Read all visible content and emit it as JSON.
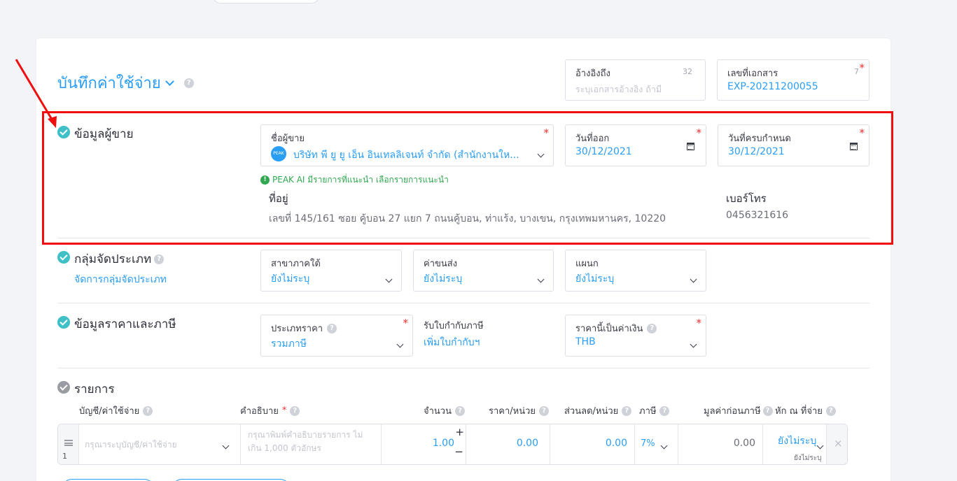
{
  "header": {
    "title": "บันทึกค่าใช้จ่าย"
  },
  "reference": {
    "label": "อ้างอิงถึง",
    "counter": "32",
    "placeholder": "ระบุเอกสารอ้างอิง ถ้ามี"
  },
  "document_no": {
    "label": "เลขที่เอกสาร",
    "counter": "7",
    "value": "EXP-20211200055"
  },
  "vendor_section": {
    "title": "ข้อมูลผู้ขาย",
    "vendor": {
      "label": "ชื่อผู้ขาย",
      "value": "บริษัท พี ยู ยู เอ็น อินเทลลิเจนท์ จำกัด (สำนักงานให...",
      "logo_text": "PEAK"
    },
    "issue_date": {
      "label": "วันที่ออก",
      "value": "30/12/2021"
    },
    "due_date": {
      "label": "วันที่ครบกำหนด",
      "value": "30/12/2021"
    },
    "ai_hint": "PEAK AI มีรายการที่แนะนำ เลือกรายการแนะนำ",
    "address_label": "ที่อยู่",
    "address": "เลขที่ 145/161 ซอย คู้บอน 27 แยก 7 ถนนคู้บอน, ท่าแร้ง, บางเขน, กรุงเทพมหานคร, 10220",
    "phone_label": "เบอร์โทร",
    "phone": "0456321616"
  },
  "group_section": {
    "title": "กลุ่มจัดประเภท",
    "manage_link": "จัดการกลุ่มจัดประเภท",
    "fields": [
      {
        "label": "สาขาภาคใต้",
        "value": "ยังไม่ระบุ"
      },
      {
        "label": "ค่าขนส่ง",
        "value": "ยังไม่ระบุ"
      },
      {
        "label": "แผนก",
        "value": "ยังไม่ระบุ"
      }
    ]
  },
  "price_section": {
    "title": "ข้อมูลราคาและภาษี",
    "price_type": {
      "label": "ประเภทราคา",
      "value": "รวมภาษี"
    },
    "tax_invoice": {
      "label": "รับใบกำกับภาษี",
      "link": "เพิ่มใบกำกับฯ"
    },
    "currency": {
      "label": "ราคานี้เป็นค่าเงิน",
      "value": "THB"
    }
  },
  "items_section": {
    "title": "รายการ",
    "columns": {
      "account": "บัญชี/ค่าใช้จ่าย",
      "description": "คำอธิบาย",
      "qty": "จำนวน",
      "unit_price": "ราคา/หน่วย",
      "discount": "ส่วนลด/หน่วย",
      "vat": "ภาษี",
      "pretax": "มูลค่าก่อนภาษี",
      "wht": "หัก ณ ที่จ่าย"
    },
    "row": {
      "index": "1",
      "account_placeholder": "กรุณาระบุบัญชี/ค่าใช้จ่าย",
      "description_placeholder": "กรุณาพิมพ์คำอธิบายรายการ ไม่เกิน 1,000 ตัวอักษร",
      "qty": "1.00",
      "unit_price": "0.00",
      "discount": "0.00",
      "vat": "7%",
      "pretax": "0.00",
      "wht": "ยังไม่ระบุ",
      "wht_sub": "ยังไม่ระบุ"
    }
  },
  "colors": {
    "accent": "#2a9df4",
    "check": "#3fbfc6",
    "highlight": "#f00e0e",
    "required": "#f0302e"
  }
}
